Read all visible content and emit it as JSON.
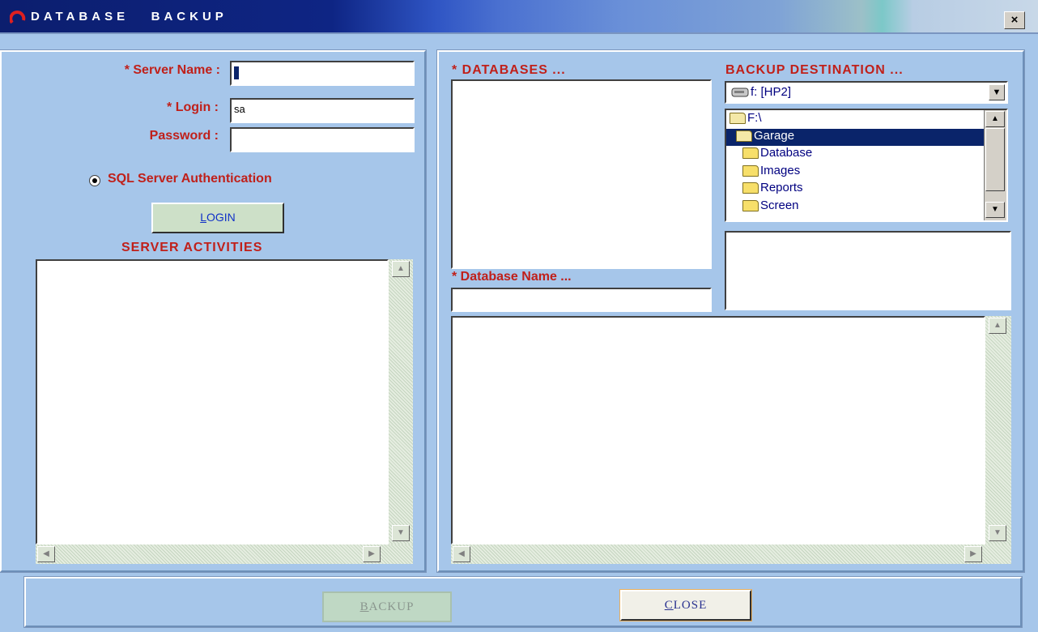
{
  "window": {
    "title": "DATABASE   BACKUP",
    "close_glyph": "×"
  },
  "login": {
    "server_name_label": "* Server Name :",
    "server_name_value": "",
    "login_label": "*  Login :",
    "login_value": "sa",
    "password_label": "Password :",
    "password_value": "",
    "auth_label": "SQL Server Authentication",
    "login_button_label": "LOGIN",
    "login_button_accel": "L"
  },
  "server_activities": {
    "title": "SERVER  ACTIVITIES"
  },
  "databases": {
    "title": "* DATABASES ...",
    "name_label": "* Database Name ...",
    "name_value": ""
  },
  "backup_destination": {
    "title": "BACKUP  DESTINATION ...",
    "drive": "f: [HP2]",
    "folders": [
      {
        "name": "F:\\",
        "level": 0,
        "open": true,
        "selected": false
      },
      {
        "name": "Garage",
        "level": 1,
        "open": true,
        "selected": true
      },
      {
        "name": "Database",
        "level": 2,
        "open": false,
        "selected": false
      },
      {
        "name": "Images",
        "level": 2,
        "open": false,
        "selected": false
      },
      {
        "name": "Reports",
        "level": 2,
        "open": false,
        "selected": false
      },
      {
        "name": "Screen",
        "level": 2,
        "open": false,
        "selected": false
      }
    ]
  },
  "footer": {
    "backup_label": "BACKUP",
    "backup_accel": "B",
    "backup_enabled": false,
    "close_label": "CLOSE",
    "close_accel": "C"
  },
  "colors": {
    "label_red": "#c0201a",
    "background": "#a6c6ea",
    "selection": "#0a246a"
  }
}
